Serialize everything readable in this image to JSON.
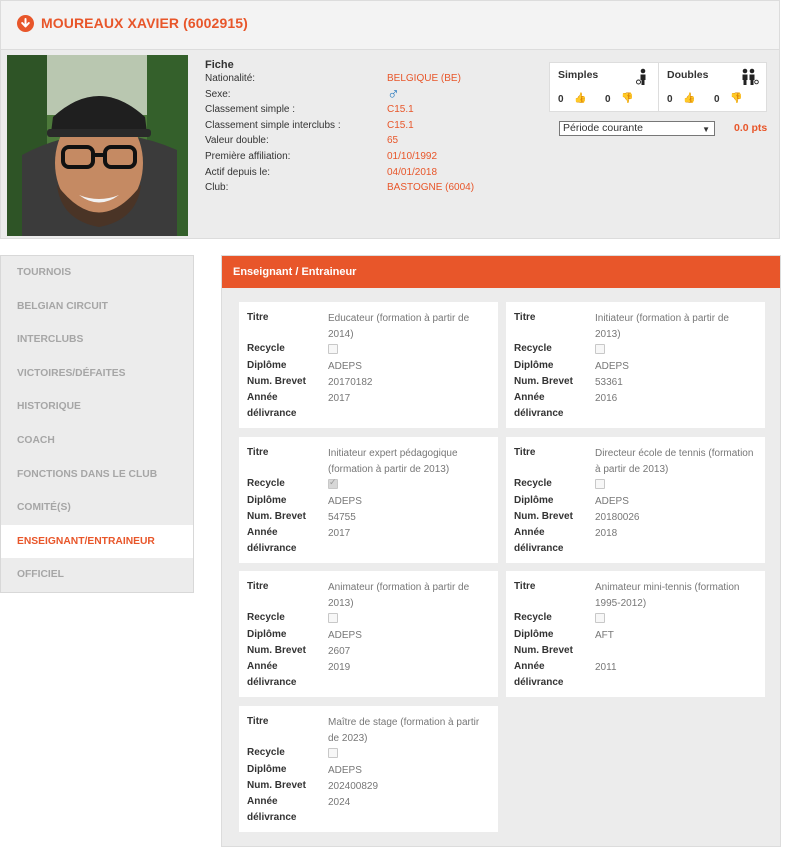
{
  "header": {
    "title": "MOUREAUX XAVIER (6002915)"
  },
  "profile": {
    "fiche_title": "Fiche",
    "rows": [
      {
        "label": "Nationalité:",
        "value": "BELGIQUE (BE)"
      },
      {
        "label": "Sexe:",
        "value": "♂"
      },
      {
        "label": "Classement simple :",
        "value": "C15.1"
      },
      {
        "label": "Classement simple interclubs :",
        "value": "C15.1"
      },
      {
        "label": "Valeur double:",
        "value": "65"
      },
      {
        "label": "Première affiliation:",
        "value": "01/10/1992"
      },
      {
        "label": "Actif depuis le:",
        "value": "04/01/2018"
      },
      {
        "label": "Club:",
        "value": "BASTOGNE (6004)"
      }
    ]
  },
  "stats": {
    "simples": {
      "label": "Simples",
      "wins": "0",
      "losses": "0"
    },
    "doubles": {
      "label": "Doubles",
      "wins": "0",
      "losses": "0"
    }
  },
  "period": {
    "selected": "Période courante",
    "points": "0.0 pts"
  },
  "sidebar": {
    "items": [
      {
        "label": "TOURNOIS"
      },
      {
        "label": "BELGIAN CIRCUIT"
      },
      {
        "label": "INTERCLUBS"
      },
      {
        "label": "VICTOIRES/DÉFAITES"
      },
      {
        "label": "HISTORIQUE"
      },
      {
        "label": "COACH"
      },
      {
        "label": "FONCTIONS DANS LE CLUB"
      },
      {
        "label": "COMITÉ(S)"
      },
      {
        "label": "ENSEIGNANT/ENTRAINEUR"
      },
      {
        "label": "OFFICIEL"
      }
    ]
  },
  "panel": {
    "title": "Enseignant / Entraineur",
    "labels": {
      "titre": "Titre",
      "recycle": "Recycle",
      "diplome": "Diplôme",
      "brevet": "Num. Brevet",
      "annee1": "Année",
      "annee2": "délivrance"
    },
    "cards": [
      {
        "titre": "Educateur (formation à partir de 2014)",
        "recycle": false,
        "diplome": "ADEPS",
        "brevet": "20170182",
        "annee": "2017"
      },
      {
        "titre": "Initiateur (formation à partir de 2013)",
        "recycle": false,
        "diplome": "ADEPS",
        "brevet": "53361",
        "annee": "2016"
      },
      {
        "titre": "Initiateur expert pédagogique (formation à partir de 2013)",
        "recycle": true,
        "diplome": "ADEPS",
        "brevet": "54755",
        "annee": "2017"
      },
      {
        "titre": "Directeur école de tennis (formation à partir de 2013)",
        "recycle": false,
        "diplome": "ADEPS",
        "brevet": "20180026",
        "annee": "2018"
      },
      {
        "titre": "Animateur (formation à partir de 2013)",
        "recycle": false,
        "diplome": "ADEPS",
        "brevet": "2607",
        "annee": "2019"
      },
      {
        "titre": "Animateur mini-tennis (formation 1995-2012)",
        "recycle": false,
        "diplome": "AFT",
        "brevet": "",
        "annee": "2011"
      },
      {
        "titre": "Maître de stage (formation à partir de 2023)",
        "recycle": false,
        "diplome": "ADEPS",
        "brevet": "202400829",
        "annee": "2024"
      }
    ]
  }
}
